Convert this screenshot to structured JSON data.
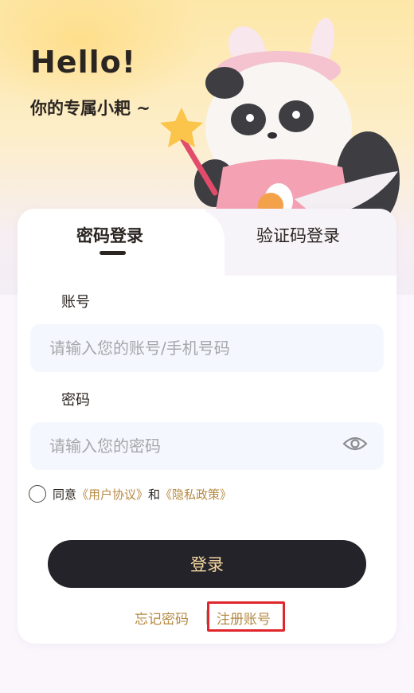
{
  "hero": {
    "title": "Hello!",
    "subtitle": "你的专属小耙 ~"
  },
  "tabs": [
    {
      "label": "密码登录",
      "active": true
    },
    {
      "label": "验证码登录",
      "active": false
    }
  ],
  "form": {
    "account_label": "账号",
    "account_placeholder": "请输入您的账号/手机号码",
    "password_label": "密码",
    "password_placeholder": "请输入您的密码"
  },
  "agreement": {
    "prefix": "同意",
    "user_agreement": "《用户协议》",
    "and": "和",
    "privacy_policy": "《隐私政策》",
    "checked": false
  },
  "login_button": "登录",
  "links": {
    "forgot_password": "忘记密码",
    "register": "注册账号"
  },
  "colors": {
    "accent_gold": "#b58a44",
    "button_dark": "#25232a",
    "button_text": "#f5d8a0",
    "highlight_red": "#e0262d"
  },
  "icons": [
    "panda-mascot-illustration",
    "eye-icon",
    "radio-icon"
  ]
}
